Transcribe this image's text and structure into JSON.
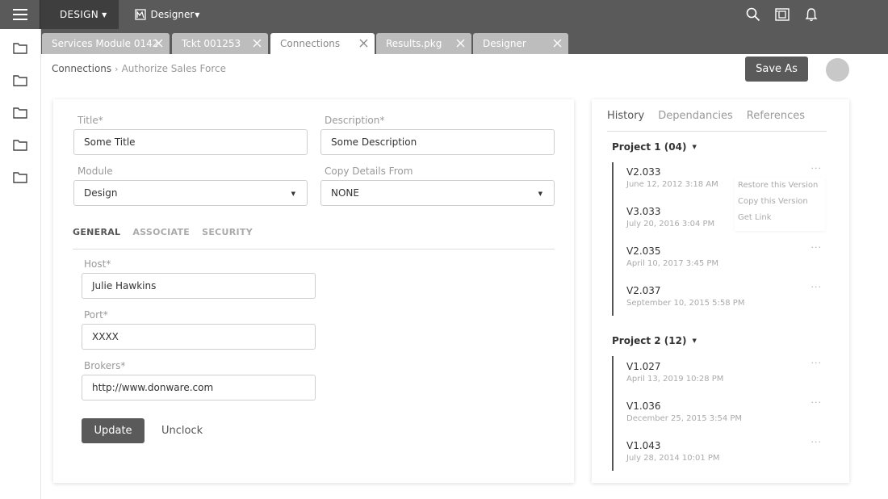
{
  "topbar": {
    "design_menu_label": "DESIGN",
    "designer_menu_label": "Designer"
  },
  "tabs": [
    {
      "label": "Services Module 0142",
      "active": false
    },
    {
      "label": "Tckt 001253",
      "active": false
    },
    {
      "label": "Connections",
      "active": true
    },
    {
      "label": "Results.pkg",
      "active": false
    },
    {
      "label": "Designer",
      "active": false
    }
  ],
  "breadcrumb": {
    "parent": "Connections",
    "separator": "›",
    "current": "Authorize Sales Force"
  },
  "actions": {
    "save_as_label": "Save As"
  },
  "form": {
    "title_label": "Title*",
    "title_value": "Some Title",
    "description_label": "Description*",
    "description_value": "Some Description",
    "module_label": "Module",
    "module_value": "Design",
    "copy_label": "Copy Details From",
    "copy_value": "NONE",
    "subtabs": [
      {
        "label": "GENERAL",
        "active": true
      },
      {
        "label": "ASSOCIATE",
        "active": false
      },
      {
        "label": "SECURITY",
        "active": false
      }
    ],
    "host_label": "Host*",
    "host_value": "Julie Hawkins",
    "port_label": "Port*",
    "port_value": "XXXX",
    "brokers_label": "Brokers*",
    "brokers_value": "http://www.donware.com",
    "update_label": "Update",
    "unclock_label": "Unclock"
  },
  "history": {
    "tabs": [
      {
        "label": "History",
        "active": true
      },
      {
        "label": "Dependancies",
        "active": false
      },
      {
        "label": "References",
        "active": false
      }
    ],
    "projects": [
      {
        "name": "Project 1 (04)",
        "versions": [
          {
            "version": "V2.033",
            "date": "June 12, 2012 3:18 AM"
          },
          {
            "version": "V3.033",
            "date": "July 20, 2016 3:04 PM"
          },
          {
            "version": "V2.035",
            "date": "April 10, 2017 3:45 PM"
          },
          {
            "version": "V2.037",
            "date": "September 10, 2015 5:58 PM"
          }
        ]
      },
      {
        "name": "Project 2 (12)",
        "versions": [
          {
            "version": "V1.027",
            "date": "April 13, 2019 10:28 PM"
          },
          {
            "version": "V1.036",
            "date": "December 25, 2015 3:54 PM"
          },
          {
            "version": "V1.043",
            "date": "July 28, 2014 10:01 PM"
          }
        ]
      }
    ],
    "more_glyph": "···",
    "context_menu": [
      "Restore this Version",
      "Copy this Version",
      "Get Link"
    ]
  }
}
